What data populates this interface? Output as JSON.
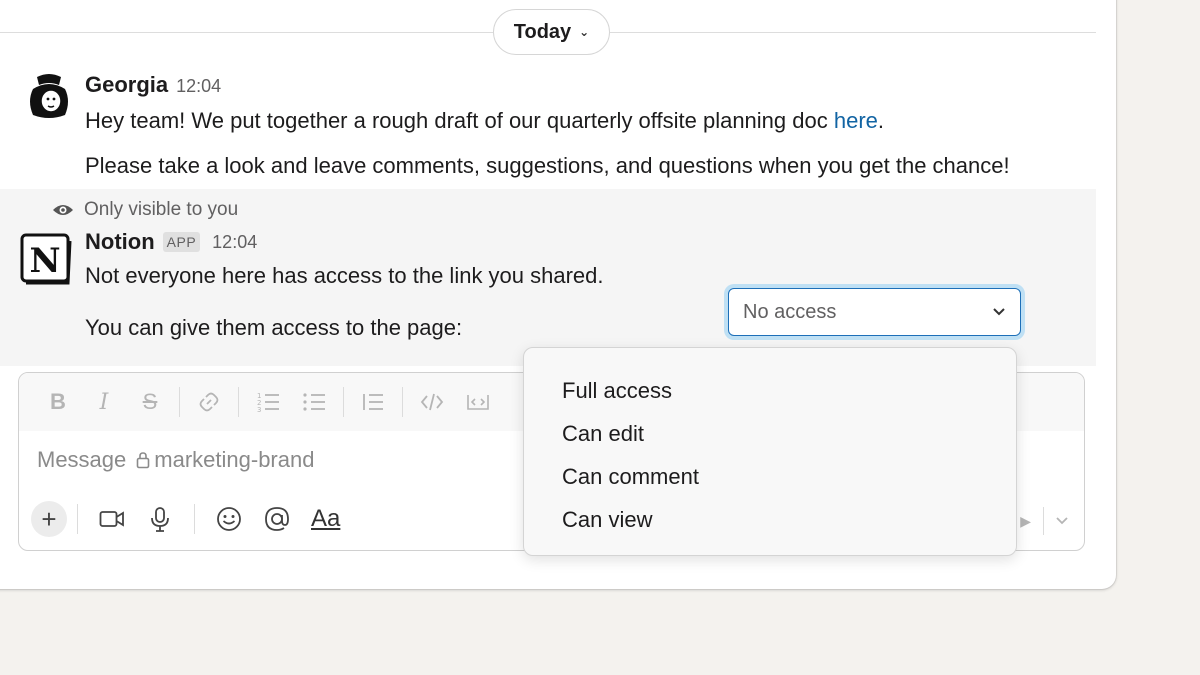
{
  "divider": {
    "label": "Today"
  },
  "georgia": {
    "name": "Georgia",
    "time": "12:04",
    "line1_text": "Hey team! We put together a rough draft of our quarterly offsite planning doc ",
    "line1_link": "here",
    "line1_end": ".",
    "line2": "Please take a look and leave comments, suggestions, and questions when you get the chance!"
  },
  "notion": {
    "visibility": "Only visible to you",
    "name": "Notion",
    "badge": "APP",
    "time": "12:04",
    "line1": "Not everyone here has access to the link you shared.",
    "line2": "You can give them access to the page:",
    "select_value": "No access"
  },
  "composer": {
    "placeholder_prefix": "Message",
    "channel": "marketing-brand",
    "format_label": "Aa"
  },
  "menu": {
    "items": [
      {
        "label": "Full access"
      },
      {
        "label": "Can edit"
      },
      {
        "label": "Can comment"
      },
      {
        "label": "Can view"
      }
    ]
  },
  "colors": {
    "link": "#1264a3",
    "focus": "#1d6fb8"
  }
}
